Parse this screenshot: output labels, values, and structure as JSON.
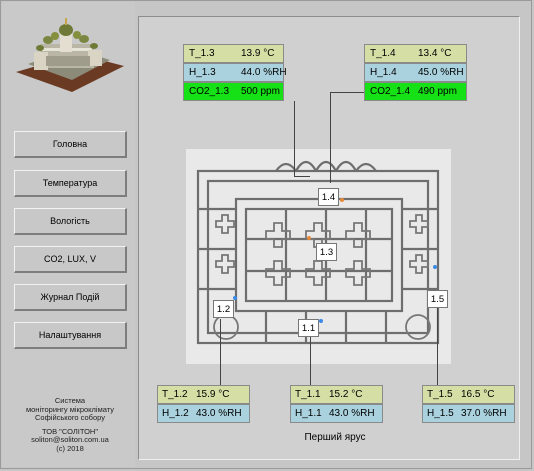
{
  "sidebar": {
    "nav": [
      "Головна",
      "Температура",
      "Вологість",
      "CO2, LUX, V",
      "Журнал Подій",
      "Налаштування"
    ],
    "info": [
      "Система",
      "моніторингу мікроклімату",
      "Софійського собору",
      "",
      "ТОВ \"СОЛІТОН\"",
      "soliton@soliton.com.ua",
      "(c) 2018"
    ]
  },
  "floor_title": "Перший ярус",
  "sensors": {
    "s13": {
      "t_label": "T_1.3",
      "t_val": "13.9 °C",
      "h_label": "H_1.3",
      "h_val": "44.0 %RH",
      "c_label": "CO2_1.3",
      "c_val": "500 ppm"
    },
    "s14": {
      "t_label": "T_1.4",
      "t_val": "13.4 °C",
      "h_label": "H_1.4",
      "h_val": "45.0 %RH",
      "c_label": "CO2_1.4",
      "c_val": "490 ppm"
    },
    "s12": {
      "t_label": "T_1.2",
      "t_val": "15.9 °C",
      "h_label": "H_1.2",
      "h_val": "43.0 %RH"
    },
    "s11": {
      "t_label": "T_1.1",
      "t_val": "15.2 °C",
      "h_label": "H_1.1",
      "h_val": "43.0 %RH"
    },
    "s15": {
      "t_label": "T_1.5",
      "t_val": "16.5 °C",
      "h_label": "H_1.5",
      "h_val": "37.0 %RH"
    }
  },
  "markers": {
    "m11": "1.1",
    "m12": "1.2",
    "m13": "1.3",
    "m14": "1.4",
    "m15": "1.5"
  },
  "colors": {
    "temp_bg": "#d5dfa5",
    "hum_bg": "#a9d2de",
    "co2_bg": "#16e016"
  }
}
